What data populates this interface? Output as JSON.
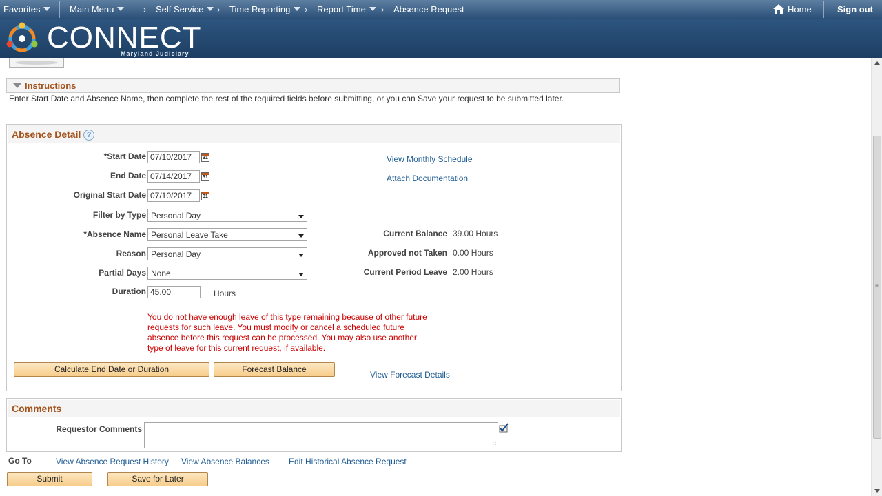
{
  "nav": {
    "favorites": "Favorites",
    "main_menu": "Main Menu",
    "breadcrumbs": [
      "Self Service",
      "Time Reporting",
      "Report Time",
      "Absence Request"
    ],
    "home": "Home",
    "sign_out": "Sign out"
  },
  "banner": {
    "logo_text": "CONNECT",
    "logo_sub": "Maryland Judiciary"
  },
  "instructions": {
    "title": "Instructions",
    "text": "Enter Start Date and Absence Name, then complete the rest of the required fields before submitting, or you can Save your request to be submitted later."
  },
  "absence_detail": {
    "title": "Absence Detail",
    "help": "?",
    "start_date_label": "*Start Date",
    "start_date": "07/10/2017",
    "end_date_label": "End Date",
    "end_date": "07/14/2017",
    "orig_start_label": "Original Start Date",
    "orig_start": "07/10/2017",
    "filter_type_label": "Filter by Type",
    "filter_type": "Personal Day",
    "absence_name_label": "*Absence Name",
    "absence_name": "Personal Leave Take",
    "reason_label": "Reason",
    "reason": "Personal Day",
    "partial_days_label": "Partial Days",
    "partial_days": "None",
    "duration_label": "Duration",
    "duration": "45.00",
    "duration_unit": "Hours",
    "view_monthly": "View Monthly Schedule",
    "attach_doc": "Attach Documentation",
    "current_balance_label": "Current Balance",
    "current_balance": "39.00 Hours",
    "approved_label": "Approved not Taken",
    "approved": "0.00 Hours",
    "period_leave_label": "Current Period Leave",
    "period_leave": "2.00 Hours",
    "error_lines": [
      "You do not have enough leave of this type remaining because of other future",
      "requests for such leave. You must modify or cancel a scheduled future",
      "absence before this request can be processed. You may also use another",
      "type of leave for this current request, if available."
    ],
    "calc_button": "Calculate End Date or Duration",
    "forecast_button": "Forecast Balance",
    "forecast_details": "View Forecast Details"
  },
  "comments": {
    "title": "Comments",
    "requestor_label": "Requestor Comments",
    "requestor_value": ""
  },
  "goto": {
    "label": "Go To",
    "links": [
      "View Absence Request History",
      "View Absence Balances",
      "Edit Historical Absence Request"
    ]
  },
  "actions": {
    "submit": "Submit",
    "save_later": "Save for Later"
  }
}
